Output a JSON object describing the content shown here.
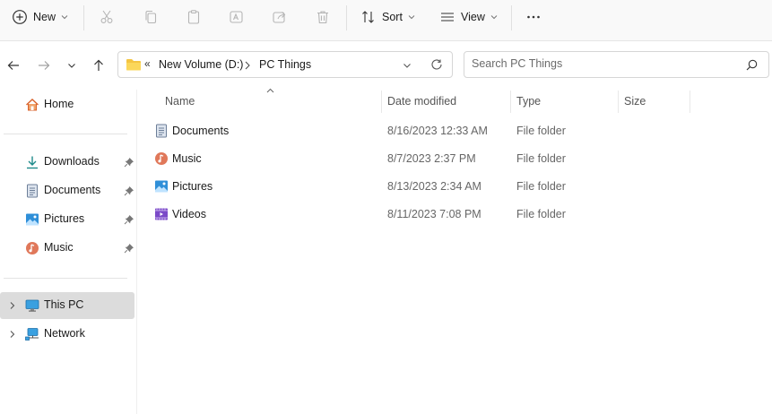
{
  "toolbar": {
    "new_label": "New",
    "sort_label": "Sort",
    "view_label": "View"
  },
  "address": {
    "overflow": "«",
    "crumbs": [
      "New Volume (D:)",
      "PC Things"
    ]
  },
  "search": {
    "placeholder": "Search PC Things"
  },
  "sidebar": {
    "home": "Home",
    "quick_access": [
      {
        "label": "Downloads",
        "icon": "download-icon",
        "pinned": true
      },
      {
        "label": "Documents",
        "icon": "documents-icon",
        "pinned": true
      },
      {
        "label": "Pictures",
        "icon": "pictures-icon",
        "pinned": true
      },
      {
        "label": "Music",
        "icon": "music-icon",
        "pinned": true
      }
    ],
    "this_pc": "This PC",
    "network": "Network"
  },
  "columns": {
    "name": "Name",
    "date": "Date modified",
    "type": "Type",
    "size": "Size"
  },
  "files": [
    {
      "name": "Documents",
      "date": "8/16/2023 12:33 AM",
      "type": "File folder",
      "icon": "documents-icon"
    },
    {
      "name": "Music",
      "date": "8/7/2023 2:37 PM",
      "type": "File folder",
      "icon": "music-icon"
    },
    {
      "name": "Pictures",
      "date": "8/13/2023 2:34 AM",
      "type": "File folder",
      "icon": "pictures-icon"
    },
    {
      "name": "Videos",
      "date": "8/11/2023 7:08 PM",
      "type": "File folder",
      "icon": "videos-icon"
    }
  ],
  "colors": {
    "accent": "#0067c0",
    "selected_bg": "#dcdcdc",
    "folder_yellow": "#f4c542"
  }
}
